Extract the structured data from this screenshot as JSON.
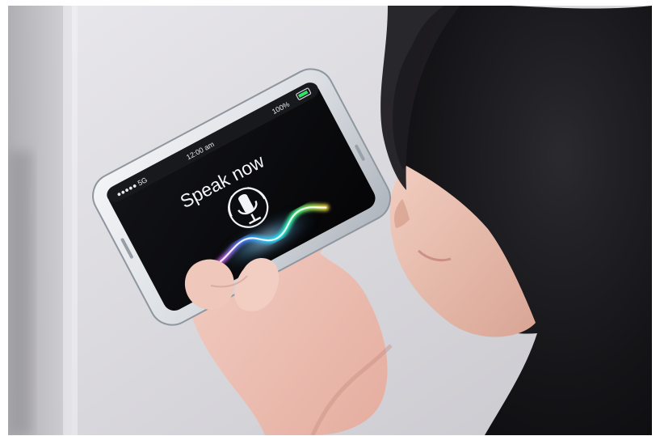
{
  "photo": {
    "subject": "Person holding a smartphone and using voice assistant",
    "background_color": "#d8d7dc",
    "hair_color": "#151417",
    "skin_color": "#e7b9ab"
  },
  "phone_screen": {
    "status_bar": {
      "signal": "●●●●● 5G",
      "time": "12:00 am",
      "battery": "100%"
    },
    "prompt": "Speak now",
    "icon": "microphone-icon",
    "accent_colors": [
      "#ff4fd8",
      "#4a7dff",
      "#1ee8ff",
      "#3bff7a",
      "#ffe34a"
    ]
  }
}
